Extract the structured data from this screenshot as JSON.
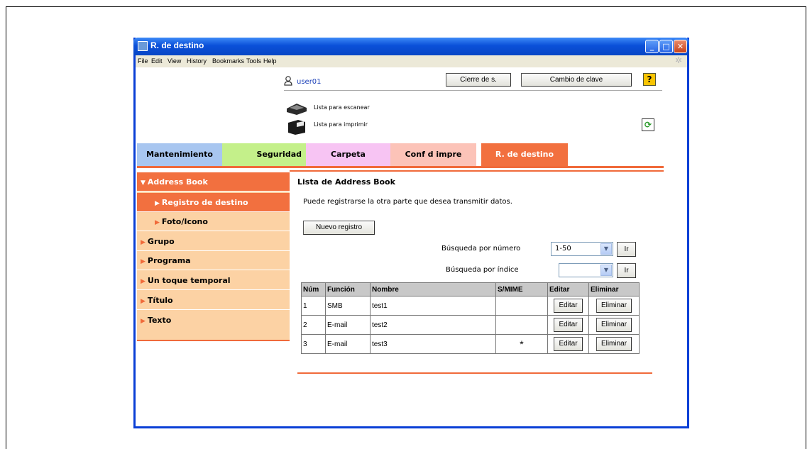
{
  "window": {
    "title": "R. de destino"
  },
  "menu": [
    "File",
    "Edit",
    "View",
    "History",
    "Bookmarks",
    "Tools",
    "Help"
  ],
  "header": {
    "user": "user01",
    "logout_label": "Cierre de s.",
    "change_password_label": "Cambio de clave",
    "help_label": "?"
  },
  "status": {
    "scan": "Lista para escanear",
    "print": "Lista para imprimir"
  },
  "tabs": [
    {
      "label": "Mantenimiento",
      "color": "#a8c6f0"
    },
    {
      "label": "Seguridad",
      "color": "#c4f08a"
    },
    {
      "label": "Carpeta",
      "color": "#f7c4f3"
    },
    {
      "label": "Conf d impre",
      "color": "#fcc3b8"
    },
    {
      "label": "R. de destino",
      "color": "#f2703f"
    }
  ],
  "sidebar": {
    "items": [
      {
        "label": "Address Book",
        "active": true,
        "marker": "▼"
      },
      {
        "label": "Registro de destino",
        "active": true,
        "marker": "▶"
      },
      {
        "label": "Foto/Icono",
        "active": false,
        "marker": "▶"
      },
      {
        "label": "Grupo",
        "active": false,
        "marker": "▶"
      },
      {
        "label": "Programa",
        "active": false,
        "marker": "▶"
      },
      {
        "label": "Un toque temporal",
        "active": false,
        "marker": "▶"
      },
      {
        "label": "Título",
        "active": false,
        "marker": "▶"
      },
      {
        "label": "Texto",
        "active": false,
        "marker": "▶"
      }
    ]
  },
  "main": {
    "title": "Lista de Address Book",
    "description": "Puede registrarse la otra parte que desea transmitir datos.",
    "new_button": "Nuevo registro",
    "search_number_label": "Búsqueda por número",
    "search_number_value": "1-50",
    "search_index_label": "Búsqueda por índice",
    "search_index_value": "",
    "go_label": "Ir"
  },
  "table": {
    "headers": [
      "Núm",
      "Función",
      "Nombre",
      "S/MIME",
      "Editar",
      "Eliminar"
    ],
    "rows": [
      {
        "num": "1",
        "func": "SMB",
        "name": "test1",
        "smime": ""
      },
      {
        "num": "2",
        "func": "E-mail",
        "name": "test2",
        "smime": ""
      },
      {
        "num": "3",
        "func": "E-mail",
        "name": "test3",
        "smime": "*"
      }
    ],
    "edit_label": "Editar",
    "delete_label": "Eliminar"
  }
}
